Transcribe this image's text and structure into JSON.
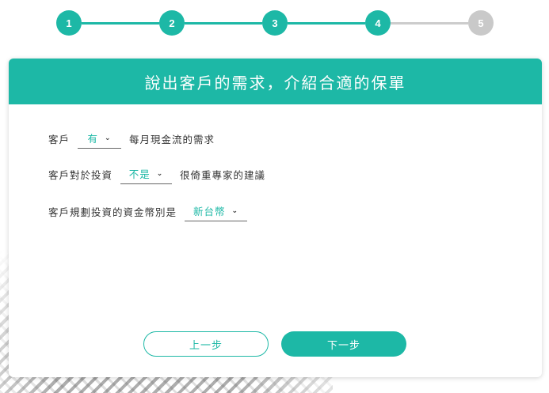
{
  "stepper": {
    "steps": [
      "1",
      "2",
      "3",
      "4",
      "5"
    ],
    "current_step": 4,
    "accent_color": "#1db8a6",
    "inactive_color": "#c9c9c9"
  },
  "card": {
    "title": "說出客戶的需求，介紹合適的保單"
  },
  "form": {
    "row1": {
      "prefix": "客戶",
      "select_value": "有",
      "suffix": "每月現金流的需求"
    },
    "row2": {
      "prefix": "客戶對於投資",
      "select_value": "不是",
      "suffix": "很倚重專家的建議"
    },
    "row3": {
      "prefix": "客戶規劃投資的資金幣別是",
      "select_value": "新台幣"
    }
  },
  "buttons": {
    "prev_label": "上一步",
    "next_label": "下一步"
  },
  "icons": {
    "select_chevron": "chevron-down-icon"
  }
}
